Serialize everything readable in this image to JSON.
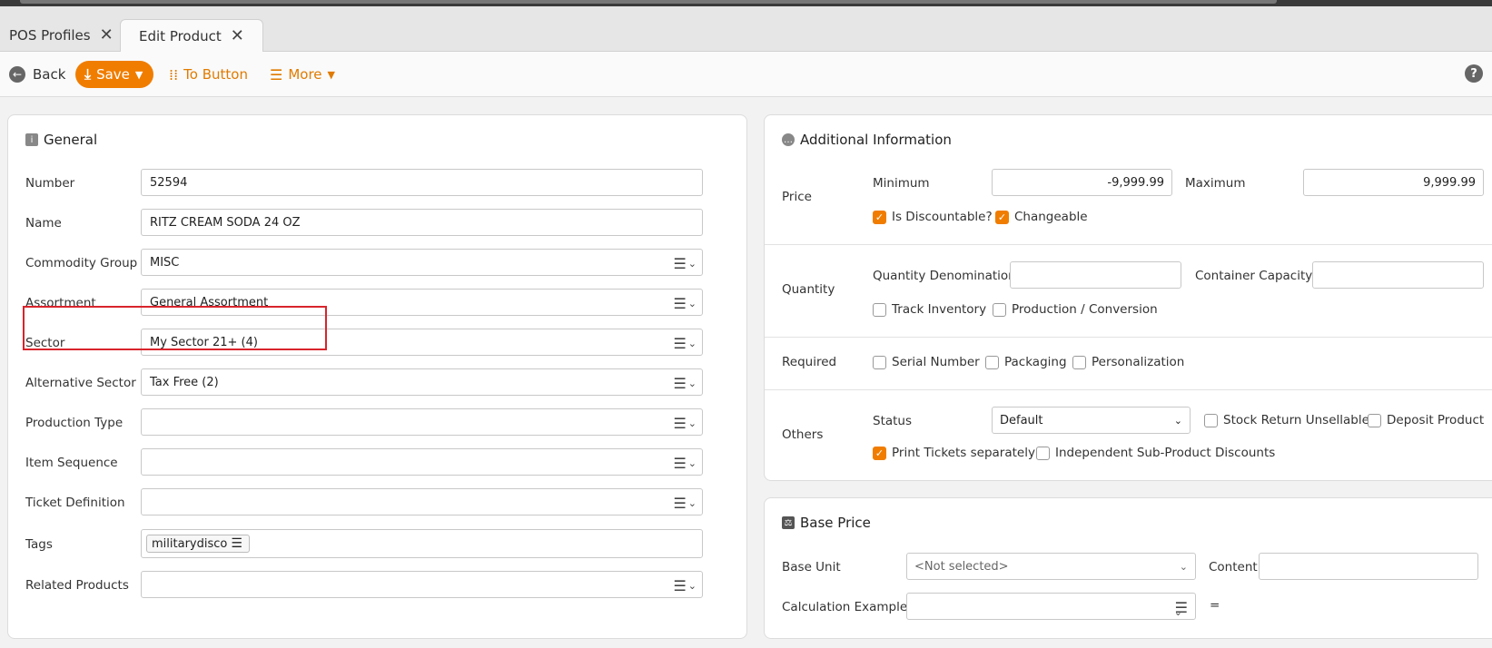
{
  "tabs": [
    {
      "label": "POS Profiles"
    },
    {
      "label": "Edit Product"
    }
  ],
  "toolbar": {
    "back_label": "Back",
    "save_label": "Save",
    "to_button_label": "To Button",
    "more_label": "More"
  },
  "general": {
    "title": "General",
    "fields": [
      {
        "label": "Number",
        "value": "52594",
        "type": "text"
      },
      {
        "label": "Name",
        "value": "RITZ CREAM SODA 24 OZ",
        "type": "text"
      },
      {
        "label": "Commodity Group",
        "value": "MISC",
        "type": "lookup"
      },
      {
        "label": "Assortment",
        "value": "General Assortment",
        "type": "lookup"
      },
      {
        "label": "Sector",
        "value": "My Sector 21+ (4)",
        "type": "lookup"
      },
      {
        "label": "Alternative Sector",
        "value": "Tax Free (2)",
        "type": "lookup"
      },
      {
        "label": "Production Type",
        "value": "",
        "type": "lookup"
      },
      {
        "label": "Item Sequence",
        "value": "",
        "type": "lookup"
      },
      {
        "label": "Ticket Definition",
        "value": "",
        "type": "lookup"
      }
    ],
    "tags_label": "Tags",
    "tag_chip": "militarydisco",
    "related_label": "Related Products"
  },
  "additional": {
    "title": "Additional Information",
    "price_label": "Price",
    "minimum_label": "Minimum",
    "minimum_value": "-9,999.99",
    "maximum_label": "Maximum",
    "maximum_value": "9,999.99",
    "is_discountable": "Is Discountable?",
    "changeable": "Changeable",
    "quantity_label": "Quantity",
    "quantity_denomination": "Quantity Denomination",
    "container_capacity": "Container Capacity",
    "track_inventory": "Track Inventory",
    "production_conversion": "Production / Conversion",
    "required_label": "Required",
    "serial_number": "Serial Number",
    "packaging": "Packaging",
    "personalization": "Personalization",
    "others_label": "Others",
    "status_label": "Status",
    "status_value": "Default",
    "stock_return": "Stock Return Unsellable?",
    "deposit_product": "Deposit Product",
    "print_tickets": "Print Tickets separately",
    "independent_discounts": "Independent Sub-Product Discounts"
  },
  "base_price": {
    "title": "Base Price",
    "base_unit_label": "Base Unit",
    "base_unit_value": "<Not selected>",
    "content_label": "Content",
    "calc_label": "Calculation Example",
    "equals": "="
  },
  "colors": {
    "accent": "#f07d00",
    "highlight": "#d8242c"
  }
}
